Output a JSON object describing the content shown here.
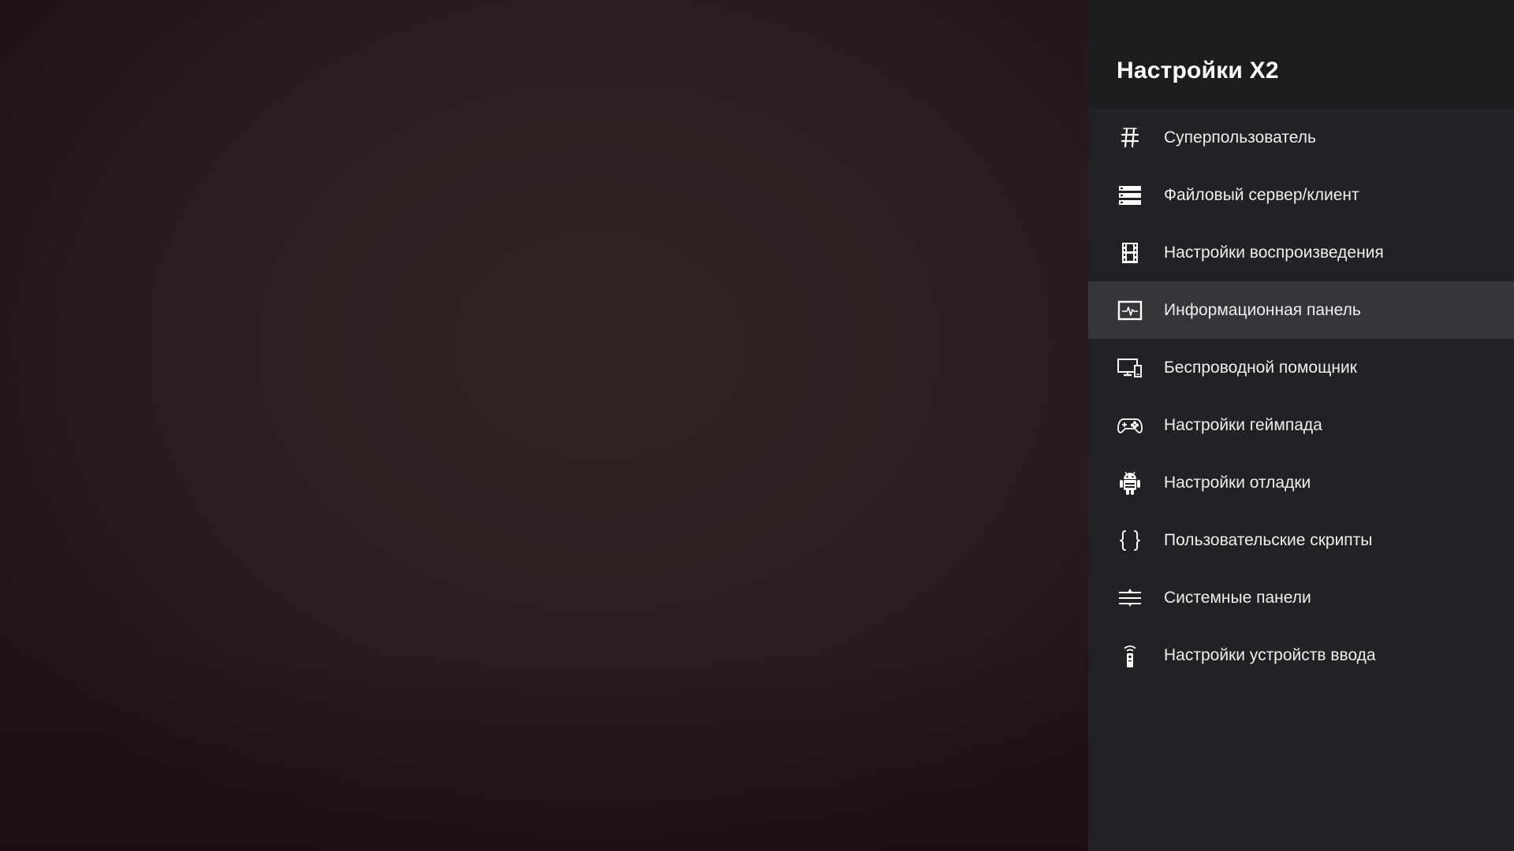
{
  "panel": {
    "title": "Настройки X2",
    "selected_index": 3,
    "items": [
      {
        "label": "Суперпользователь",
        "icon": "hash-icon"
      },
      {
        "label": "Файловый сервер/клиент",
        "icon": "server-icon"
      },
      {
        "label": "Настройки воспроизведения",
        "icon": "film-icon"
      },
      {
        "label": "Информационная панель",
        "icon": "monitor-pulse-icon"
      },
      {
        "label": "Беспроводной помощник",
        "icon": "devices-icon"
      },
      {
        "label": "Настройки геймпада",
        "icon": "gamepad-icon"
      },
      {
        "label": "Настройки отладки",
        "icon": "android-icon"
      },
      {
        "label": "Пользовательские скрипты",
        "icon": "braces-icon"
      },
      {
        "label": "Системные панели",
        "icon": "sliders-icon"
      },
      {
        "label": "Настройки устройств ввода",
        "icon": "remote-icon"
      }
    ]
  },
  "colors": {
    "panel_bg": "#222226",
    "header_bg": "#1d1d20",
    "selected_bg": "#36363a",
    "text": "#eeeeee",
    "backdrop": "#2d1f21"
  }
}
